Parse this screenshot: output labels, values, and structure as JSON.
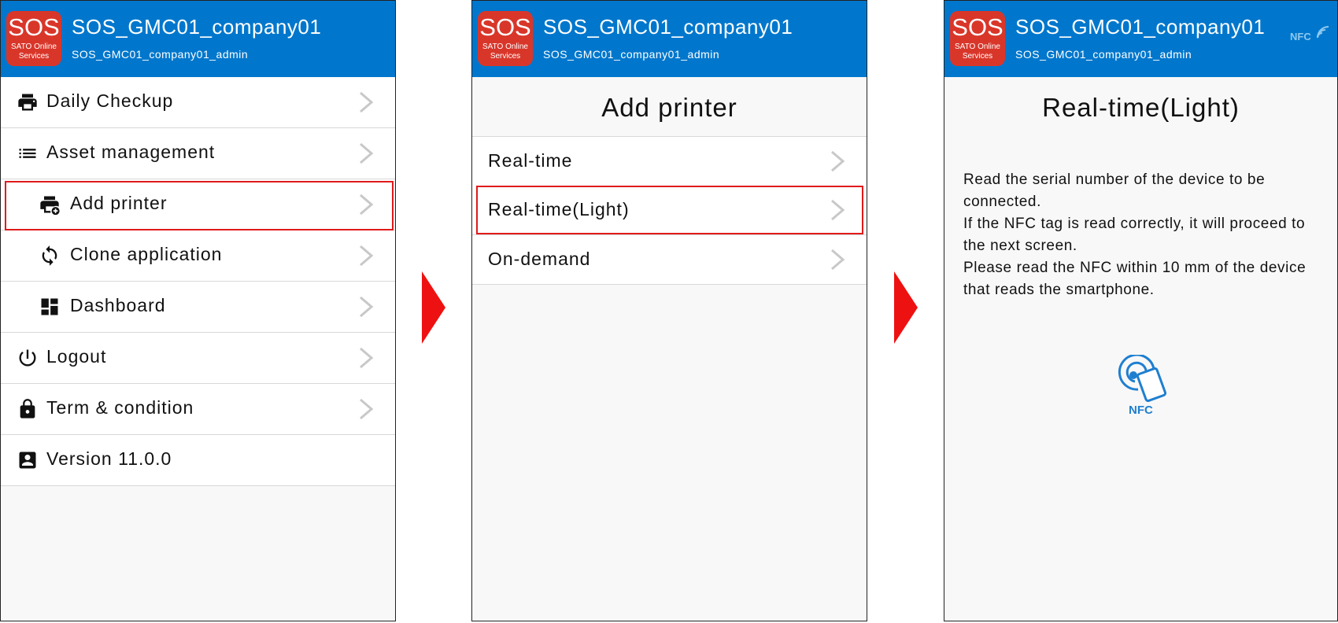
{
  "header": {
    "logo_main": "SOS",
    "logo_sub_line1": "SATO Online",
    "logo_sub_line2": "Services",
    "title": "SOS_GMC01_company01",
    "subtitle": "SOS_GMC01_company01_admin",
    "nfc_badge": "NFC"
  },
  "screen1": {
    "menu": [
      {
        "label": "Daily Checkup",
        "icon": "printer-icon"
      },
      {
        "label": "Asset management",
        "icon": "list-icon"
      },
      {
        "label": "Add printer",
        "icon": "add-printer-icon",
        "highlighted": true
      },
      {
        "label": "Clone application",
        "icon": "sync-icon"
      },
      {
        "label": "Dashboard",
        "icon": "dashboard-icon"
      },
      {
        "label": "Logout",
        "icon": "power-icon"
      },
      {
        "label": "Term & condition",
        "icon": "lock-icon"
      },
      {
        "label": "Version 11.0.0",
        "icon": "account-box-icon"
      }
    ]
  },
  "screen2": {
    "title": "Add printer",
    "options": [
      {
        "label": "Real-time"
      },
      {
        "label": "Real-time(Light)",
        "highlighted": true
      },
      {
        "label": "On-demand"
      }
    ]
  },
  "screen3": {
    "title": "Real-time(Light)",
    "instructions": [
      "Read the serial number of the device to be connected.",
      "If the NFC tag is read correctly, it will proceed to the next screen.",
      "Please read the NFC within 10 mm of the device that reads the smartphone."
    ],
    "nfc_label": "NFC"
  },
  "colors": {
    "header_blue": "#0077cc",
    "logo_red": "#d9362a",
    "highlight_red": "#e01b1b",
    "arrow_red": "#ee1111",
    "nfc_blue": "#1e7fd0"
  }
}
